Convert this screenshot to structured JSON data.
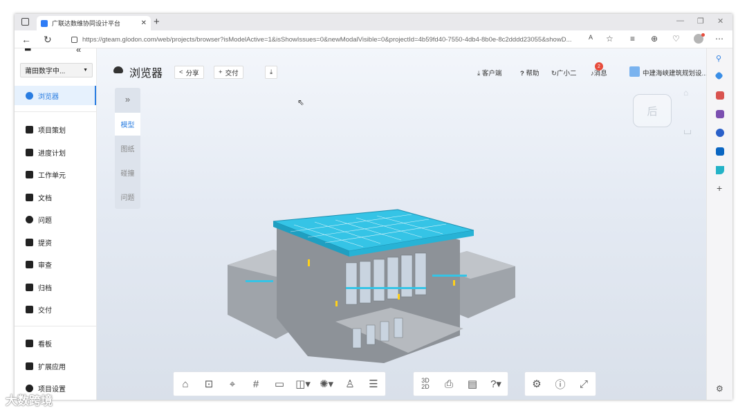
{
  "browser": {
    "tab_title": "广联达数维协同设计平台",
    "url": "https://gteam.glodon.com/web/projects/browser?isModelActive=1&isShowIssues=0&newModalVisible=0&projectId=4b59fd40-7550-4db4-8b0e-8c2dddd23055&showD...",
    "new_tab_symbol": "+"
  },
  "sidebar": {
    "project": "莆田数字中...",
    "items": [
      {
        "label": "浏览器",
        "icon": "browser-icon",
        "active": true
      },
      {
        "label": "项目策划",
        "icon": "flag-icon"
      },
      {
        "label": "进度计划",
        "icon": "schedule-icon"
      },
      {
        "label": "工作单元",
        "icon": "cube-icon"
      },
      {
        "label": "文档",
        "icon": "document-icon"
      },
      {
        "label": "问题",
        "icon": "question-icon"
      },
      {
        "label": "提资",
        "icon": "submit-icon"
      },
      {
        "label": "审查",
        "icon": "review-icon"
      },
      {
        "label": "归档",
        "icon": "archive-icon"
      },
      {
        "label": "交付",
        "icon": "deliver-icon"
      },
      {
        "label": "看板",
        "icon": "dashboard-icon"
      },
      {
        "label": "扩展应用",
        "icon": "apps-icon"
      },
      {
        "label": "项目设置",
        "icon": "settings-icon"
      }
    ]
  },
  "header": {
    "title": "浏览器",
    "share": "分享",
    "deliver": "交付",
    "client": "客户端",
    "help": "帮助",
    "assistant": "广小二",
    "messages": "消息",
    "message_count": "2",
    "user": "中建海峡建筑规划设..."
  },
  "view_tabs": [
    "模型",
    "图纸",
    "碰撞",
    "问题"
  ],
  "view_tabs_toggle": "»",
  "viewcube_face": "后",
  "toolbar": {
    "group1": [
      "home-icon",
      "zoom-fit-icon",
      "measure-icon",
      "grid-icon",
      "section-box-icon",
      "section-plane-icon",
      "explode-icon",
      "person-icon",
      "properties-icon"
    ],
    "group2": [
      "3d-2d-toggle-icon",
      "camera-icon",
      "annotation-icon",
      "help-question-icon"
    ],
    "group3": [
      "settings-icon",
      "info-icon",
      "fullscreen-icon"
    ],
    "toggle_3d": "3D",
    "toggle_2d": "2D"
  },
  "watermark": "大数跨境",
  "colors": {
    "accent": "#2a7de1",
    "roof": "#35c4e6",
    "building": "#a9adb3"
  }
}
